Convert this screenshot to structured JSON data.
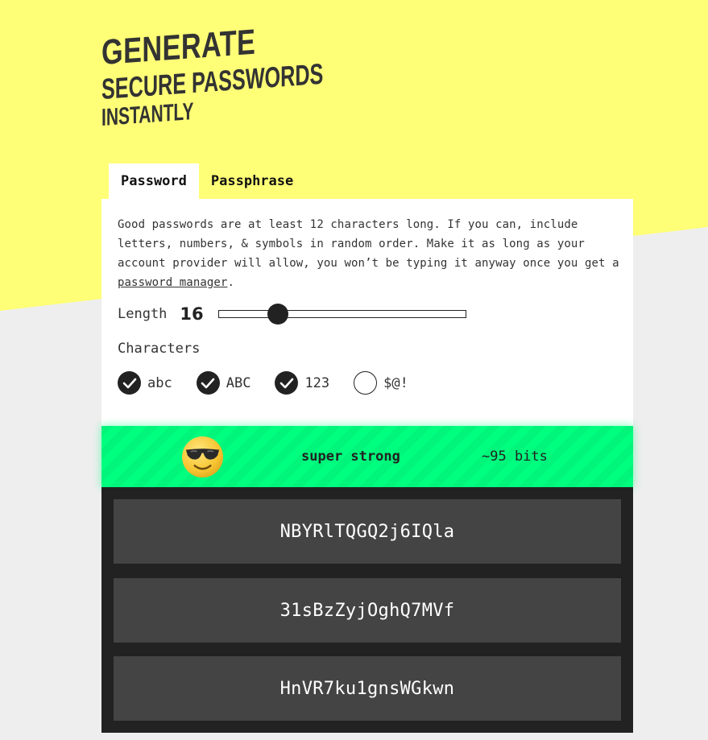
{
  "headline": {
    "line1": "GENERATE",
    "line2": "SECURE PASSWORDS",
    "line3": "INSTANTLY"
  },
  "tabs": [
    {
      "label": "Password",
      "active": true
    },
    {
      "label": "Passphrase",
      "active": false
    }
  ],
  "description": {
    "text": "Good passwords are at least 12 characters long. If you can, include letters, numbers, & symbols in random order. Make it as long as your account provider will allow, you won’t be typing it anyway once you get a ",
    "link": "password manager",
    "end": "."
  },
  "length": {
    "label": "Length",
    "value": "16",
    "level": 0.24
  },
  "characters": {
    "label": "Characters",
    "options": [
      {
        "label": "abc",
        "checked": true
      },
      {
        "label": "ABC",
        "checked": true
      },
      {
        "label": "123",
        "checked": true
      },
      {
        "label": "$@!",
        "checked": false
      }
    ]
  },
  "strength": {
    "label": "super strong",
    "bits": "~95 bits",
    "emoji_icon": "smiling-face-with-sunglasses-icon",
    "color": "#00ff7f"
  },
  "passwords": [
    "NBYRlTQGQ2j6IQla",
    "31sBzZyjOghQ7MVf",
    "HnVR7ku1gnsWGkwn"
  ],
  "colors": {
    "yellow": "#ffff77",
    "background": "#eeeeee",
    "dark": "#222222",
    "password_box": "#444444"
  }
}
